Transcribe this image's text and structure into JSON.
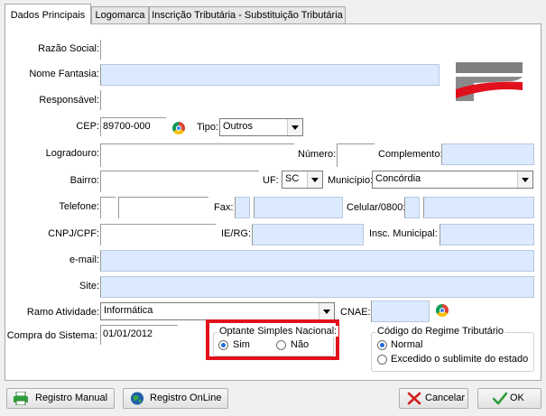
{
  "tabs": [
    {
      "label": "Dados Principais",
      "active": true
    },
    {
      "label": "Logomarca",
      "active": false
    },
    {
      "label": "Inscrição Tributária - Substituição Tributária",
      "active": false
    }
  ],
  "form": {
    "razao_social": {
      "label": "Razão Social:",
      "value": ""
    },
    "nome_fantasia": {
      "label": "Nome Fantasia:",
      "value": ""
    },
    "responsavel": {
      "label": "Responsável:",
      "value": ""
    },
    "cep": {
      "label": "CEP:",
      "value": "89700-000"
    },
    "tipo": {
      "label": "Tipo:",
      "value": "Outros"
    },
    "logradouro": {
      "label": "Logradouro:",
      "value": ""
    },
    "numero": {
      "label": "Número:",
      "value": ""
    },
    "complemento": {
      "label": "Complemento:",
      "value": ""
    },
    "bairro": {
      "label": "Bairro:",
      "value": ""
    },
    "uf": {
      "label": "UF:",
      "value": "SC"
    },
    "municipio": {
      "label": "Município:",
      "value": "Concórdia"
    },
    "telefone": {
      "label": "Telefone:",
      "value": ""
    },
    "fax": {
      "label": "Fax:",
      "value": ""
    },
    "celular": {
      "label": "Celular/0800:",
      "value": ""
    },
    "cnpj_cpf": {
      "label": "CNPJ/CPF:",
      "value": ""
    },
    "ie_rg": {
      "label": "IE/RG:",
      "value": ""
    },
    "insc_municipal": {
      "label": "Insc. Municipal:",
      "value": ""
    },
    "email": {
      "label": "e-mail:",
      "value": ""
    },
    "site": {
      "label": "Site:",
      "value": ""
    },
    "ramo_atividade": {
      "label": "Ramo Atividade:",
      "value": "Informática"
    },
    "cnae": {
      "label": "CNAE:",
      "value": ""
    },
    "compra_sistema": {
      "label": "Compra do Sistema:",
      "value": "01/01/2012"
    }
  },
  "optante": {
    "title": "Optante Simples Nacional:",
    "sim": "Sim",
    "nao": "Não",
    "selected": "Sim",
    "highlight_color": "#e0101c"
  },
  "regime": {
    "title": "Código do Regime Tributário",
    "normal": "Normal",
    "excedido": "Excedido o sublimite do estado",
    "selected": "Normal"
  },
  "buttons": {
    "registro_manual": "Registro Manual",
    "registro_online": "Registro OnLine",
    "cancelar": "Cancelar",
    "ok": "OK"
  },
  "colors": {
    "field_blue": "#dbeaff",
    "logo_red": "#e0101c",
    "logo_gray": "#7f7f7f"
  }
}
